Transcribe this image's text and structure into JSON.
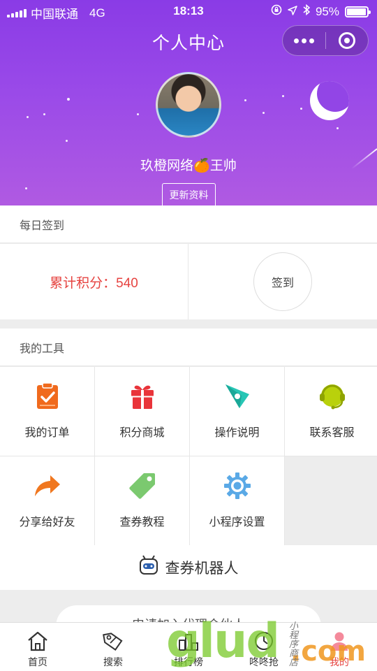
{
  "status_bar": {
    "carrier": "中国联通",
    "network": "4G",
    "time": "18:13",
    "battery": "95%",
    "battery_level": 0.95
  },
  "nav": {
    "title": "个人中心"
  },
  "profile": {
    "name": "玖橙网络🍊王帅",
    "edit_label": "更新资料"
  },
  "checkin": {
    "section_title": "每日签到",
    "points_label": "累计积分：540",
    "button_label": "签到"
  },
  "tools": {
    "section_title": "我的工具",
    "items": [
      {
        "label": "我的订单",
        "icon": "clipboard-check-icon"
      },
      {
        "label": "积分商城",
        "icon": "gift-icon"
      },
      {
        "label": "操作说明",
        "icon": "compass-icon"
      },
      {
        "label": "联系客服",
        "icon": "headset-icon"
      },
      {
        "label": "分享给好友",
        "icon": "share-arrow-icon"
      },
      {
        "label": "查券教程",
        "icon": "tag-icon"
      },
      {
        "label": "小程序设置",
        "icon": "gear-icon"
      }
    ]
  },
  "robot": {
    "label": "查券机器人"
  },
  "agent": {
    "label": "申请加入代理合伙人"
  },
  "tabbar": {
    "items": [
      {
        "label": "首页",
        "icon": "home-icon"
      },
      {
        "label": "搜索",
        "icon": "tag-search-icon"
      },
      {
        "label": "排行榜",
        "icon": "rank-icon"
      },
      {
        "label": "咚咚抢",
        "icon": "clock-icon"
      },
      {
        "label": "我的",
        "icon": "user-icon"
      }
    ],
    "active_index": 4
  },
  "watermark": {
    "main": "glud",
    "suffix": ".com",
    "caption": "小程序商店"
  },
  "colors": {
    "accent": "#e64340",
    "hero": "#9245e6"
  }
}
